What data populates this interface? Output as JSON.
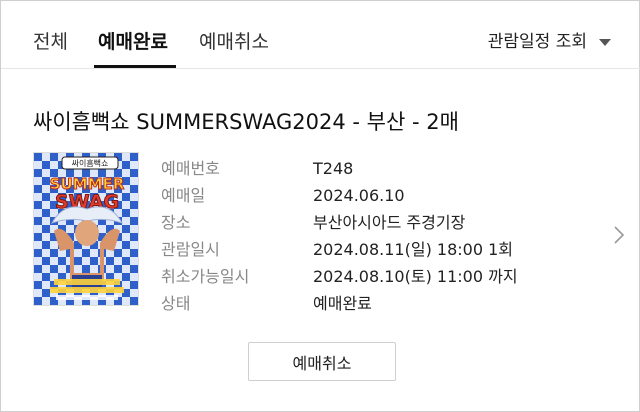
{
  "tabs": [
    {
      "label": "전체",
      "active": false
    },
    {
      "label": "예매완료",
      "active": true
    },
    {
      "label": "예매취소",
      "active": false
    }
  ],
  "schedule_filter": {
    "label": "관람일정 조회",
    "icon": "caret-down-icon"
  },
  "booking": {
    "title": "싸이흠뻑쇼 SUMMERSWAG2024 - 부산 - 2매",
    "details": [
      {
        "key": "예매번호",
        "value": "T248"
      },
      {
        "key": "예매일",
        "value": "2024.06.10"
      },
      {
        "key": "장소",
        "value": "부산아시아드 주경기장"
      },
      {
        "key": "관람일시",
        "value": "2024.08.11(일) 18:00 1회"
      },
      {
        "key": "취소가능일시",
        "value": "2024.08.10(토) 11:00 까지"
      },
      {
        "key": "상태",
        "value": "예매완료"
      }
    ],
    "cancel_button": "예매취소",
    "detail_icon": "chevron-right-icon"
  },
  "poster": {
    "banner_text": "싸이흠뻑쇼",
    "logo_text_1": "SUMMER",
    "logo_text_2": "SWAG",
    "colors": {
      "blue": "#2f5fc8",
      "light": "#dfe8fa",
      "red": "#e53a2b",
      "yellow": "#ffd33c"
    }
  }
}
